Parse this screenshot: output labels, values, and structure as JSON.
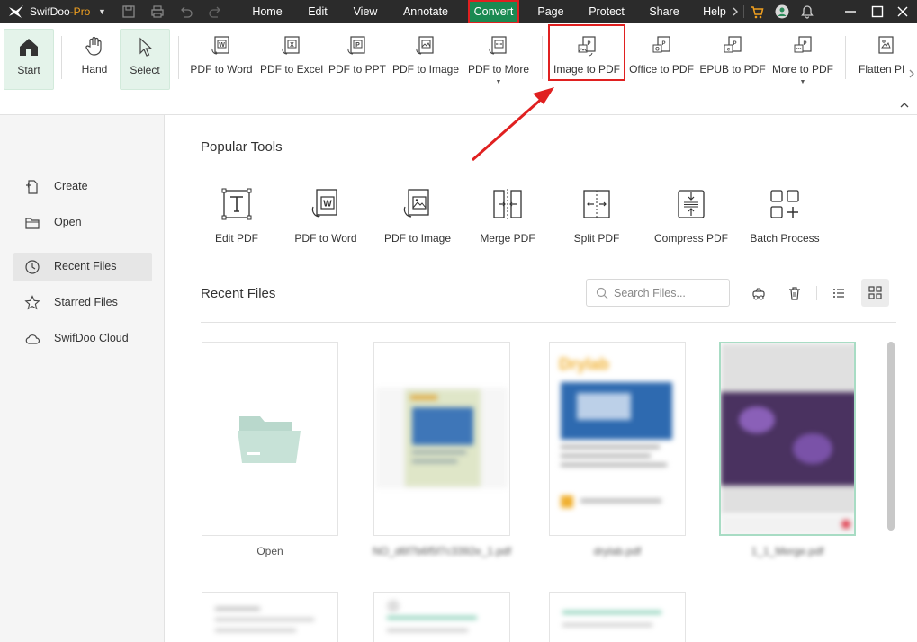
{
  "titlebar": {
    "app_name": "SwifDoo",
    "app_edition": "-Pro",
    "menus": [
      {
        "label": "Home",
        "active": false
      },
      {
        "label": "Edit",
        "active": false
      },
      {
        "label": "View",
        "active": false
      },
      {
        "label": "Annotate",
        "active": false
      },
      {
        "label": "Convert",
        "active": true
      },
      {
        "label": "Page",
        "active": false
      },
      {
        "label": "Protect",
        "active": false
      },
      {
        "label": "Share",
        "active": false
      },
      {
        "label": "Help",
        "active": false
      }
    ],
    "colors": {
      "background": "#2b2b2b",
      "active_tab": "#1a8a52",
      "highlight": "#e02020",
      "cart": "#f0a020"
    }
  },
  "ribbon": {
    "start": "Start",
    "hand": "Hand",
    "select": "Select",
    "pdf_to_word": "PDF to Word",
    "pdf_to_excel": "PDF to Excel",
    "pdf_to_ppt": "PDF to PPT",
    "pdf_to_image": "PDF to Image",
    "pdf_to_more": "PDF to More",
    "image_to_pdf": "Image to PDF",
    "office_to_pdf": "Office to PDF",
    "epub_to_pdf": "EPUB to PDF",
    "more_to_pdf": "More to PDF",
    "flatten": "Flatten PI"
  },
  "sidebar": {
    "items": [
      {
        "label": "Create",
        "icon": "create-icon",
        "active": false
      },
      {
        "label": "Open",
        "icon": "folder-icon",
        "active": false
      },
      {
        "label": "Recent Files",
        "icon": "clock-icon",
        "active": true
      },
      {
        "label": "Starred Files",
        "icon": "star-icon",
        "active": false
      },
      {
        "label": "SwifDoo Cloud",
        "icon": "cloud-icon",
        "active": false
      }
    ]
  },
  "main": {
    "popular_title": "Popular Tools",
    "tools": [
      {
        "label": "Edit PDF",
        "icon": "edit-text-icon"
      },
      {
        "label": "PDF to Word",
        "icon": "pdf-to-word-icon"
      },
      {
        "label": "PDF to Image",
        "icon": "pdf-to-image-icon"
      },
      {
        "label": "Merge PDF",
        "icon": "merge-icon"
      },
      {
        "label": "Split PDF",
        "icon": "split-icon"
      },
      {
        "label": "Compress PDF",
        "icon": "compress-icon"
      },
      {
        "label": "Batch Process",
        "icon": "batch-icon"
      }
    ],
    "recent_title": "Recent Files",
    "search_placeholder": "Search Files...",
    "files": [
      {
        "name": "Open",
        "blurred": false
      },
      {
        "name": "NO_d6f7b6f5f7c3392e_1.pdf",
        "blurred": true
      },
      {
        "name": "drylab.pdf",
        "blurred": true
      },
      {
        "name": "1_1_Merge.pdf",
        "blurred": true
      }
    ],
    "thumb_brand_text": "Drylab"
  }
}
